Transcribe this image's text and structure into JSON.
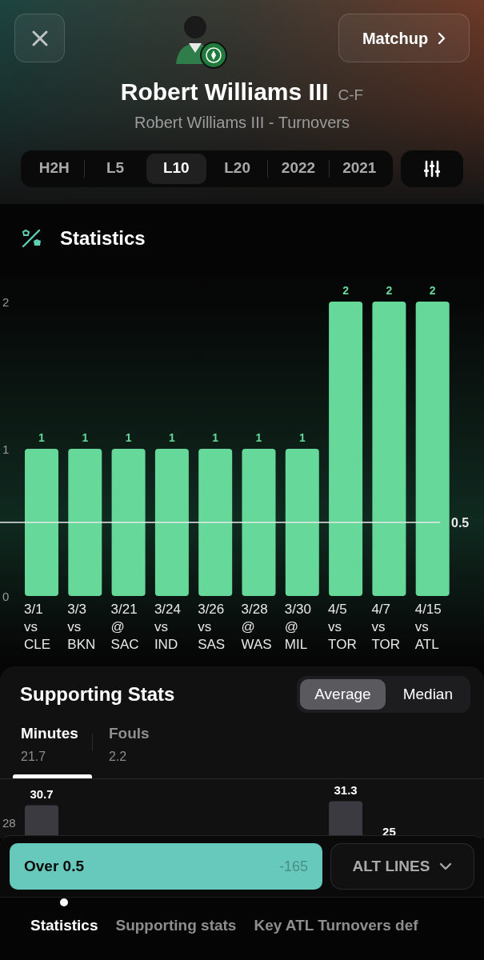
{
  "header": {
    "matchup_button": {
      "label": "Matchup"
    },
    "player": {
      "name": "Robert Williams III",
      "position": "C-F",
      "subtitle": "Robert Williams III - Turnovers"
    }
  },
  "range_tabs": [
    {
      "label": "H2H",
      "selected": false
    },
    {
      "label": "L5",
      "selected": false
    },
    {
      "label": "L10",
      "selected": true
    },
    {
      "label": "L20",
      "selected": false
    },
    {
      "label": "2022",
      "selected": false
    },
    {
      "label": "2021",
      "selected": false
    }
  ],
  "statistics": {
    "title": "Statistics",
    "chart_data": {
      "type": "bar",
      "categories": [
        "3/1 vs CLE",
        "3/3 vs BKN",
        "3/21 @ SAC",
        "3/24 vs IND",
        "3/26 vs SAS",
        "3/28 @ WAS",
        "3/30 @ MIL",
        "4/5 vs TOR",
        "4/7 vs TOR",
        "4/15 vs ATL"
      ],
      "series": [
        {
          "color": "#66d99a",
          "values": [
            1,
            1,
            1,
            1,
            1,
            1,
            1,
            2,
            2,
            2
          ]
        }
      ],
      "ylim": [
        0,
        2
      ],
      "yticks": [
        0,
        1,
        2
      ],
      "data_labels": true,
      "ref_lines": [
        {
          "axis": "y",
          "value": 0.5,
          "label": "0.5"
        }
      ]
    }
  },
  "supporting_stats": {
    "title": "Supporting Stats",
    "toggle": [
      {
        "label": "Average",
        "selected": true
      },
      {
        "label": "Median",
        "selected": false
      }
    ],
    "tabs": [
      {
        "label": "Minutes",
        "value": "21.7",
        "selected": true
      },
      {
        "label": "Fouls",
        "value": "2.2",
        "selected": false
      }
    ],
    "minutes_chart": {
      "tick": "28",
      "bars": [
        {
          "kind": "bar",
          "label": "30.7"
        },
        {
          "kind": "hidden"
        },
        {
          "kind": "hidden"
        },
        {
          "kind": "hidden"
        },
        {
          "kind": "hidden"
        },
        {
          "kind": "hidden"
        },
        {
          "kind": "hidden"
        },
        {
          "kind": "bar",
          "label": "31.3"
        },
        {
          "kind": "label_only",
          "label": "25"
        },
        {
          "kind": "hidden"
        }
      ]
    }
  },
  "bet_bar": {
    "selection": {
      "label": "Over 0.5",
      "odds": "-165"
    },
    "alt_lines": {
      "label": "ALT LINES"
    }
  },
  "bottom_tabs": [
    {
      "label": "Statistics",
      "selected": true
    },
    {
      "label": "Supporting stats",
      "selected": false
    },
    {
      "label": "Key ATL Turnovers def",
      "selected": false
    }
  ]
}
